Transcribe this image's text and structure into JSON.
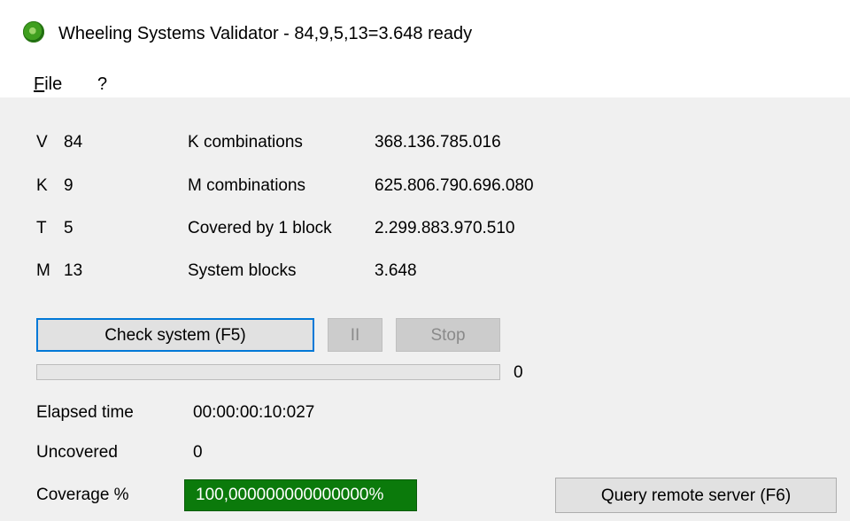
{
  "window": {
    "title": "Wheeling Systems Validator - 84,9,5,13=3.648 ready",
    "icon": "green-gear-icon"
  },
  "menu": {
    "file_first": "F",
    "file_rest": "ile",
    "help": "?"
  },
  "params": [
    {
      "key": "V",
      "value": "84"
    },
    {
      "key": "K",
      "value": "9"
    },
    {
      "key": "T",
      "value": "5"
    },
    {
      "key": "M",
      "value": "13"
    }
  ],
  "stats": [
    {
      "label": "K combinations",
      "value": "368.136.785.016"
    },
    {
      "label": "M combinations",
      "value": "625.806.790.696.080"
    },
    {
      "label": "Covered by 1 block",
      "value": "2.299.883.970.510"
    },
    {
      "label": "System blocks",
      "value": "3.648"
    }
  ],
  "buttons": {
    "check": "Check system (F5)",
    "pause": "II",
    "stop": "Stop",
    "query": "Query remote server (F6)"
  },
  "progress": {
    "fraction": 0,
    "count": "0"
  },
  "results": {
    "elapsed_label": "Elapsed time",
    "elapsed_value": "00:00:00:10:027",
    "uncovered_label": "Uncovered",
    "uncovered_value": "0",
    "coverage_label": "Coverage %",
    "coverage_value": "100,000000000000000%"
  },
  "colors": {
    "coverage_bg": "#0b7a0b",
    "focus_border": "#0078d7"
  }
}
